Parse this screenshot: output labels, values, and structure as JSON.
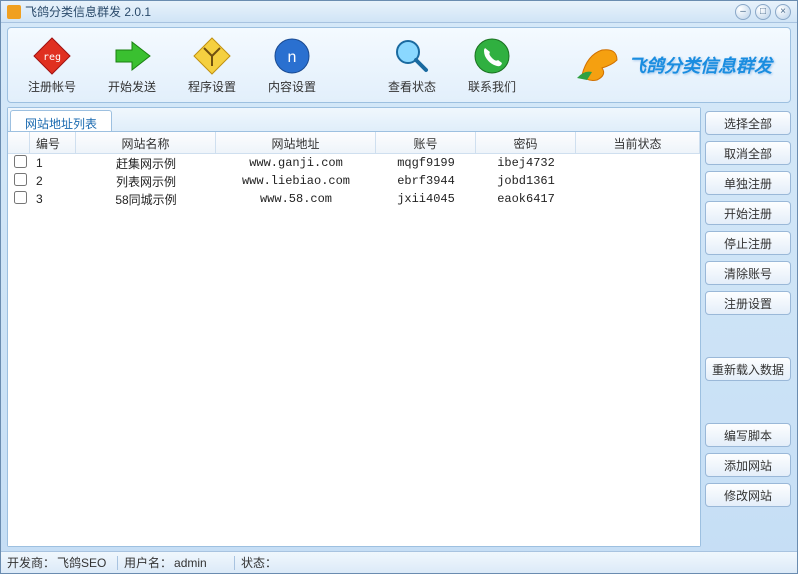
{
  "title": "飞鸽分类信息群发 2.0.1",
  "toolbar": {
    "register": "注册帐号",
    "start_send": "开始发送",
    "prog_settings": "程序设置",
    "content_settings": "内容设置",
    "view_status": "查看状态",
    "contact": "联系我们"
  },
  "brand": "飞鸽分类信息群发",
  "tab": "网站地址列表",
  "columns": {
    "num": "编号",
    "name": "网站名称",
    "url": "网站地址",
    "acc": "账号",
    "pwd": "密码",
    "stat": "当前状态"
  },
  "rows": [
    {
      "num": "1",
      "name": "赶集网示例",
      "url": "www.ganji.com",
      "acc": "mqgf9199",
      "pwd": "ibej4732",
      "stat": ""
    },
    {
      "num": "2",
      "name": "列表网示例",
      "url": "www.liebiao.com",
      "acc": "ebrf3944",
      "pwd": "jobd1361",
      "stat": ""
    },
    {
      "num": "3",
      "name": "58同城示例",
      "url": "www.58.com",
      "acc": "jxii4045",
      "pwd": "eaok6417",
      "stat": ""
    }
  ],
  "side": {
    "select_all": "选择全部",
    "deselect_all": "取消全部",
    "single_reg": "单独注册",
    "start_reg": "开始注册",
    "stop_reg": "停止注册",
    "clear_acc": "清除账号",
    "reg_settings": "注册设置",
    "reload_data": "重新载入数据",
    "write_script": "编写脚本",
    "add_site": "添加网站",
    "edit_site": "修改网站"
  },
  "status": {
    "dev_label": "开发商：",
    "dev_value": "飞鸽SEO",
    "user_label": "用户名：",
    "user_value": "admin",
    "state_label": "状态：",
    "state_value": ""
  }
}
